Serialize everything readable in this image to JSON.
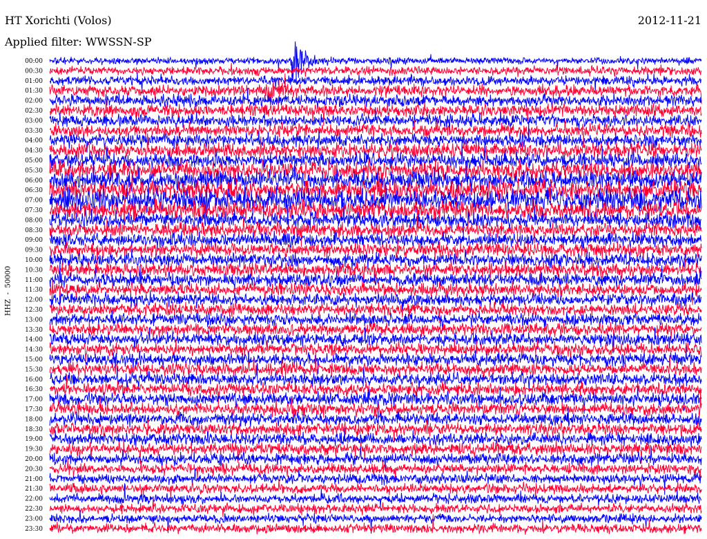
{
  "header": {
    "station": "HT Xorichti (Volos)",
    "date": "2012-11-21",
    "filter_text": "Applied filter: WWSSN-SP"
  },
  "chart_data": {
    "type": "line",
    "subtype": "helicorder-seismogram",
    "title": "HT Xorichti (Volos)",
    "date": "2012-11-21",
    "filter": "WWSSN-SP",
    "ylabel": "HHZ  -  50000",
    "row_interval_minutes": 30,
    "row_labels": [
      "00:00",
      "00:30",
      "01:00",
      "01:30",
      "02:00",
      "02:30",
      "03:00",
      "03:30",
      "04:00",
      "04:30",
      "05:00",
      "05:30",
      "06:00",
      "06:30",
      "07:00",
      "07:30",
      "08:00",
      "08:30",
      "09:00",
      "09:30",
      "10:00",
      "10:30",
      "11:00",
      "11:30",
      "12:00",
      "12:30",
      "13:00",
      "13:30",
      "14:00",
      "14:30",
      "15:00",
      "15:30",
      "16:00",
      "16:30",
      "17:00",
      "17:30",
      "18:00",
      "18:30",
      "19:00",
      "19:30",
      "20:00",
      "20:30",
      "21:00",
      "21:30",
      "22:00",
      "22:30",
      "23:00",
      "23:30"
    ],
    "series_colors": [
      "#0000ff",
      "#ff0033"
    ],
    "relative_amplitude": [
      0.55,
      0.7,
      0.8,
      0.9,
      0.95,
      1.0,
      1.0,
      1.0,
      1.05,
      1.15,
      1.2,
      1.4,
      1.5,
      1.6,
      1.7,
      1.4,
      1.25,
      1.15,
      1.1,
      1.1,
      1.1,
      1.1,
      1.05,
      1.05,
      1.0,
      1.0,
      1.0,
      1.0,
      1.0,
      1.0,
      1.0,
      1.0,
      1.0,
      1.0,
      1.0,
      1.0,
      1.0,
      1.0,
      1.0,
      0.95,
      0.9,
      0.85,
      0.8,
      0.8,
      0.75,
      0.75,
      0.7,
      0.75
    ],
    "events": [
      {
        "row_label": "00:00",
        "minute_offset": 11.2,
        "relative_peak": 6.5
      },
      {
        "row_label": "01:30",
        "minute_offset": 10.0,
        "relative_peak": 1.5
      }
    ],
    "grid": false
  }
}
